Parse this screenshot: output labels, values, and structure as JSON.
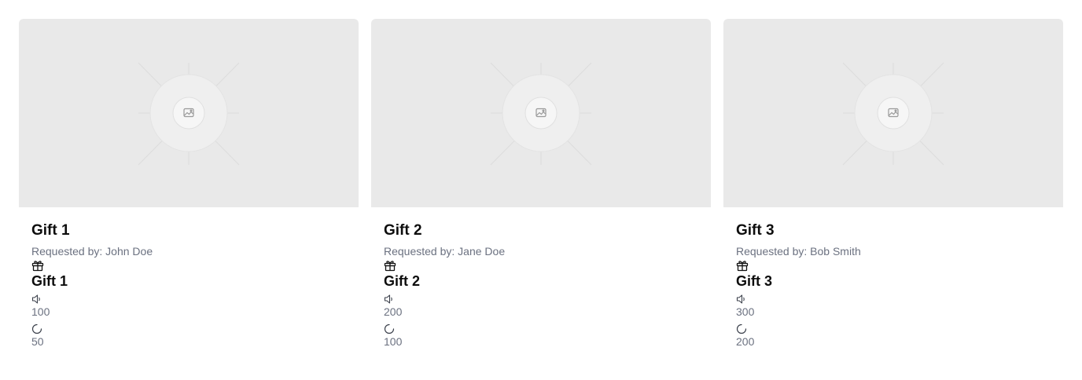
{
  "gifts": [
    {
      "title": "Gift 1",
      "requested_by": "Requested by: John Doe",
      "name": "Gift 1",
      "value_a": "100",
      "value_b": "50"
    },
    {
      "title": "Gift 2",
      "requested_by": "Requested by: Jane Doe",
      "name": "Gift 2",
      "value_a": "200",
      "value_b": "100"
    },
    {
      "title": "Gift 3",
      "requested_by": "Requested by: Bob Smith",
      "name": "Gift 3",
      "value_a": "300",
      "value_b": "200"
    }
  ],
  "icons": {
    "placeholder": "image-placeholder-icon",
    "gift": "gift-icon",
    "volume": "speaker-icon",
    "progress": "loading-spinner-icon"
  },
  "colors": {
    "thumb_bg": "#e9e9e9",
    "muted_text": "#6b7180",
    "title_text": "#0d0d0d"
  }
}
